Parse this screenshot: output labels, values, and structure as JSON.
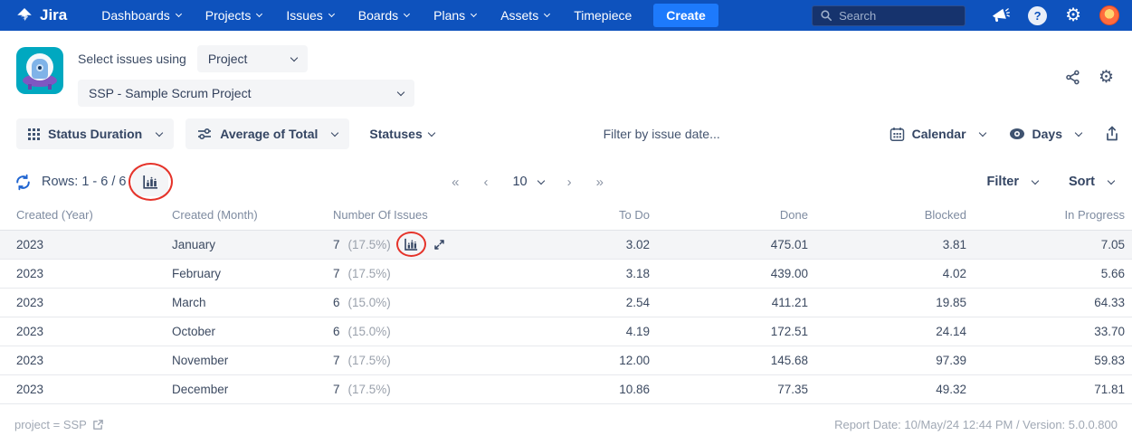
{
  "nav": {
    "brand": "Jira",
    "items": [
      {
        "label": "Dashboards"
      },
      {
        "label": "Projects"
      },
      {
        "label": "Issues"
      },
      {
        "label": "Boards"
      },
      {
        "label": "Plans"
      },
      {
        "label": "Assets"
      },
      {
        "label": "Timepiece"
      }
    ],
    "create_label": "Create",
    "search_placeholder": "Search",
    "help_glyph": "?",
    "gear_glyph": "⚙"
  },
  "header": {
    "select_label": "Select issues using",
    "mode_value": "Project",
    "project_value": "SSP - Sample Scrum Project",
    "gear_glyph": "⚙"
  },
  "toolbar": {
    "report_type": "Status Duration",
    "aggregation": "Average of Total",
    "statuses_label": "Statuses",
    "date_filter_placeholder": "Filter by issue date...",
    "calendar_label": "Calendar",
    "unit_label": "Days"
  },
  "rowsbar": {
    "rows_label": "Rows: 1 - 6 / 6",
    "first": "«",
    "prev": "‹",
    "page_size": "10",
    "next": "›",
    "last": "»",
    "filter_label": "Filter",
    "sort_label": "Sort"
  },
  "table": {
    "columns": [
      "Created (Year)",
      "Created (Month)",
      "Number Of Issues",
      "To Do",
      "Done",
      "Blocked",
      "In Progress"
    ],
    "rows": [
      {
        "year": "2023",
        "month": "January",
        "issues": "7",
        "percent": "(17.5%)",
        "to_do": "3.02",
        "done": "475.01",
        "blocked": "3.81",
        "in_progress": "7.05"
      },
      {
        "year": "2023",
        "month": "February",
        "issues": "7",
        "percent": "(17.5%)",
        "to_do": "3.18",
        "done": "439.00",
        "blocked": "4.02",
        "in_progress": "5.66"
      },
      {
        "year": "2023",
        "month": "March",
        "issues": "6",
        "percent": "(15.0%)",
        "to_do": "2.54",
        "done": "411.21",
        "blocked": "19.85",
        "in_progress": "64.33"
      },
      {
        "year": "2023",
        "month": "October",
        "issues": "6",
        "percent": "(15.0%)",
        "to_do": "4.19",
        "done": "172.51",
        "blocked": "24.14",
        "in_progress": "33.70"
      },
      {
        "year": "2023",
        "month": "November",
        "issues": "7",
        "percent": "(17.5%)",
        "to_do": "12.00",
        "done": "145.68",
        "blocked": "97.39",
        "in_progress": "59.83"
      },
      {
        "year": "2023",
        "month": "December",
        "issues": "7",
        "percent": "(17.5%)",
        "to_do": "10.86",
        "done": "77.35",
        "blocked": "49.32",
        "in_progress": "71.81"
      }
    ]
  },
  "footer": {
    "left_text": "project = SSP",
    "right_text": "Report Date: 10/May/24 12:44 PM / Version: 5.0.0.800"
  },
  "colors": {
    "nav_bg": "#0E52BD",
    "create_bg": "#1D7AFC",
    "accent_blue": "#2065D1",
    "annotation_red": "#E5332A",
    "app_icon_teal": "#00A8C0",
    "app_icon_purple": "#7E57C2"
  }
}
